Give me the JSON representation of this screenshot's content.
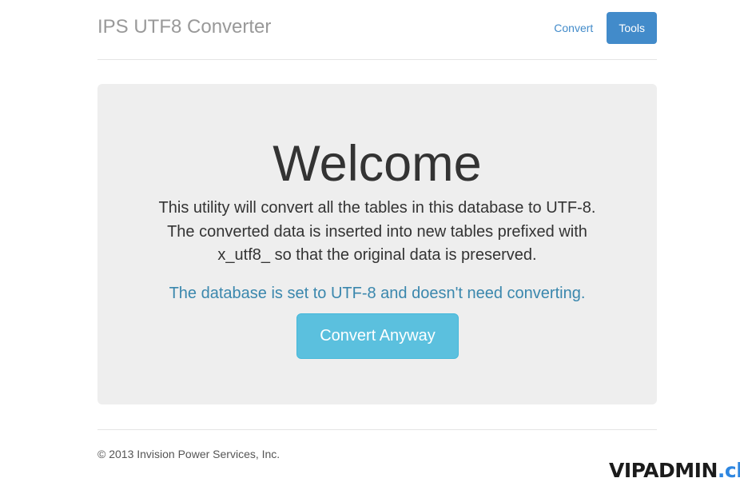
{
  "header": {
    "brand": "IPS UTF8 Converter",
    "nav": {
      "convert_label": "Convert",
      "tools_label": "Tools",
      "active": "Tools"
    }
  },
  "main": {
    "title": "Welcome",
    "intro_lines": [
      "This utility will convert all the tables in this database to UTF-8.",
      "The converted data is inserted into new tables prefixed with",
      "x_utf8_ so that the original data is preserved."
    ],
    "notice": "The database is set to UTF-8 and doesn't need converting.",
    "button_label": "Convert Anyway"
  },
  "footer": {
    "copyright": "© 2013 Invision Power Services, Inc."
  },
  "watermark": {
    "main": "VIPADMIN",
    "suffix": ".club"
  },
  "colors": {
    "nav_link": "#428bca",
    "active_tab": "#428bca",
    "jumbotron_bg": "#eeeeee",
    "notice_text": "#3a87ad",
    "button_bg": "#5bc0de"
  }
}
